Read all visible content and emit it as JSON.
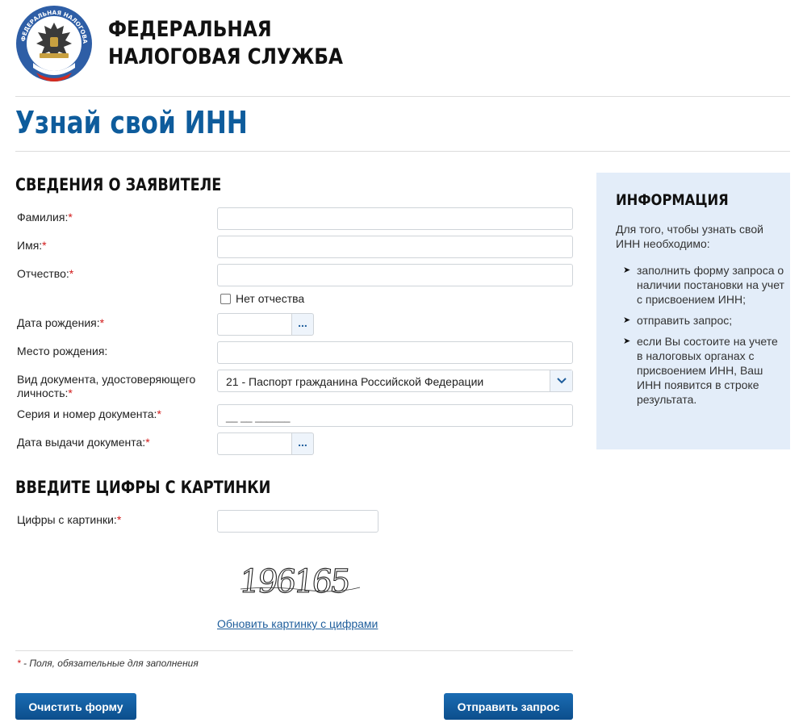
{
  "header": {
    "org_name_line1": "ФЕДЕРАЛЬНАЯ",
    "org_name_line2": "НАЛОГОВАЯ СЛУЖБА",
    "logo_icon": "fns-emblem-icon",
    "logo_text": "ФЕДЕРАЛЬНАЯ НАЛОГОВАЯ СЛУЖБА"
  },
  "page_title": "Узнай свой ИНН",
  "applicant": {
    "section_title": "СВЕДЕНИЯ О ЗАЯВИТЕЛЕ",
    "required_mark": "*",
    "last_name_label": "Фамилия:",
    "first_name_label": "Имя:",
    "patronymic_label": "Отчество:",
    "no_patronymic_label": "Нет отчества",
    "birth_date_label": "Дата рождения:",
    "birth_place_label": "Место рождения:",
    "doc_type_label_line1": "Вид документа, удостоверяющего",
    "doc_type_label_line2": "личность:",
    "doc_type_value": "21 - Паспорт гражданина Российской Федерации",
    "doc_number_label": "Серия и номер документа:",
    "doc_number_mask": "__ __ ______",
    "issue_date_label": "Дата выдачи документа:",
    "date_button_label": "..."
  },
  "captcha": {
    "section_title": "ВВЕДИТЕ ЦИФРЫ С КАРТИНКИ",
    "label": "Цифры с картинки:",
    "image_text": "196165",
    "refresh_link": "Обновить картинку с цифрами"
  },
  "footer": {
    "required_star": "*",
    "required_note": " - Поля, обязательные для заполнения",
    "clear_button": "Очистить форму",
    "submit_button": "Отправить запрос"
  },
  "info": {
    "title": "ИНФОРМАЦИЯ",
    "intro": "Для того, чтобы узнать свой ИНН необходимо:",
    "items": [
      "заполнить форму запроса о наличии постановки на учет с присвоением ИНН;",
      "отправить запрос;",
      "если Вы состоите на учете в налоговых органах с присвоением ИНН, Ваш ИНН появится в строке результата."
    ]
  },
  "colors": {
    "brand_blue": "#0e5c9c",
    "info_bg": "#e3edf9",
    "required_red": "#d21a1a"
  }
}
